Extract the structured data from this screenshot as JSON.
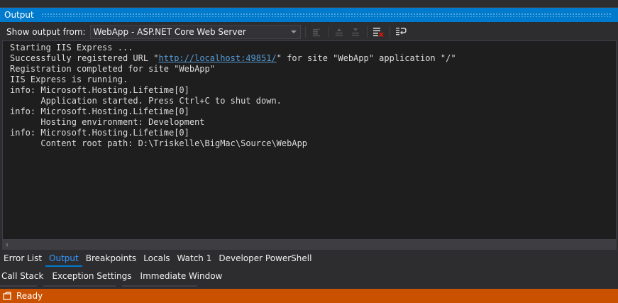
{
  "panel": {
    "title": "Output"
  },
  "toolbar": {
    "show_output_label": "Show output from:",
    "source_value": "WebApp - ASP.NET Core Web Server",
    "icons": [
      "find-message-icon",
      "go-to-previous-message-icon",
      "go-to-next-message-icon",
      "clear-all-icon",
      "toggle-word-wrap-icon"
    ]
  },
  "output": {
    "lines": [
      "Starting IIS Express ...",
      "Successfully registered URL \"",
      "Registration completed for site \"WebApp\"",
      "IIS Express is running.",
      "info: Microsoft.Hosting.Lifetime[0]",
      "      Application started. Press Ctrl+C to shut down.",
      "info: Microsoft.Hosting.Lifetime[0]",
      "      Hosting environment: Development",
      "info: Microsoft.Hosting.Lifetime[0]",
      "      Content root path: D:\\Triskelle\\BigMac\\Source\\WebApp"
    ],
    "url_line": {
      "prefix": "Successfully registered URL \"",
      "link": "http://localhost:49851/",
      "suffix": "\" for site \"WebApp\" application \"/\""
    }
  },
  "tabs_row1": [
    "Error List",
    "Output",
    "Breakpoints",
    "Locals",
    "Watch 1",
    "Developer PowerShell"
  ],
  "tabs_row2": [
    "Call Stack",
    "Exception Settings",
    "Immediate Window"
  ],
  "active_tab": "Output",
  "status": {
    "text": "Ready"
  },
  "colors": {
    "accent": "#007acc",
    "status_bar": "#ca5100",
    "link": "#569cd6",
    "active_tab_text": "#3399ff"
  }
}
